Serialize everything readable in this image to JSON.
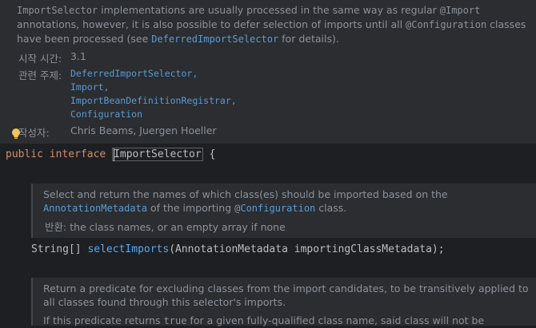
{
  "type_doc": {
    "desc_line1_code": "ImportSelector",
    "desc_line1_text": " implementations are usually processed in the same way as regular ",
    "desc_line1_code2": "@Import",
    "desc_line2": "annotations, however, it is also possible to defer selection of imports until all ",
    "desc_line2_code": "@Configuration",
    "desc_line2_end": " classes",
    "desc_line3_start": "have been processed (see ",
    "desc_line3_link": "DeferredImportSelector",
    "desc_line3_end": " for details).",
    "since_label": "시작 시간:",
    "since_value": "3.1",
    "see_label": "관련 주제:",
    "see_items": [
      "DeferredImportSelector,",
      "Import,",
      "ImportBeanDefinitionRegistrar,",
      "Configuration"
    ],
    "author_label": "작성자:",
    "author_value": "Chris Beams, Juergen Hoeller"
  },
  "declaration": {
    "kw_public": "public",
    "kw_interface": "interface",
    "name": "ImportSelector",
    "brace": "{"
  },
  "method1_doc": {
    "line1": "Select and return the names of which class(es) should be imported based on the",
    "line2_link": "AnnotationMetadata",
    "line2_mid": " of the importing ",
    "line2_at": "@",
    "line2_link2": "Configuration",
    "line2_end": " class.",
    "returns_label": "반환:",
    "returns_value": " the class names, or an empty array if none"
  },
  "method1": {
    "ret_type": "String[]",
    "name": "selectImports",
    "params": "(AnnotationMetadata importingClassMetadata);"
  },
  "method2_doc": {
    "line1": "Return a predicate for excluding classes from the import candidates, to be transitively applied to",
    "line2": "all classes found through this selector's imports.",
    "line3_start": "If this predicate returns ",
    "line3_code": "true",
    "line3_end": " for a given fully-qualified class name, said class will not be"
  },
  "colors": {
    "background": "#1e1f22",
    "doc_background": "#2b2d30",
    "keyword": "#cf8e6d",
    "method": "#56a8f5",
    "link": "#5a9bd5"
  }
}
